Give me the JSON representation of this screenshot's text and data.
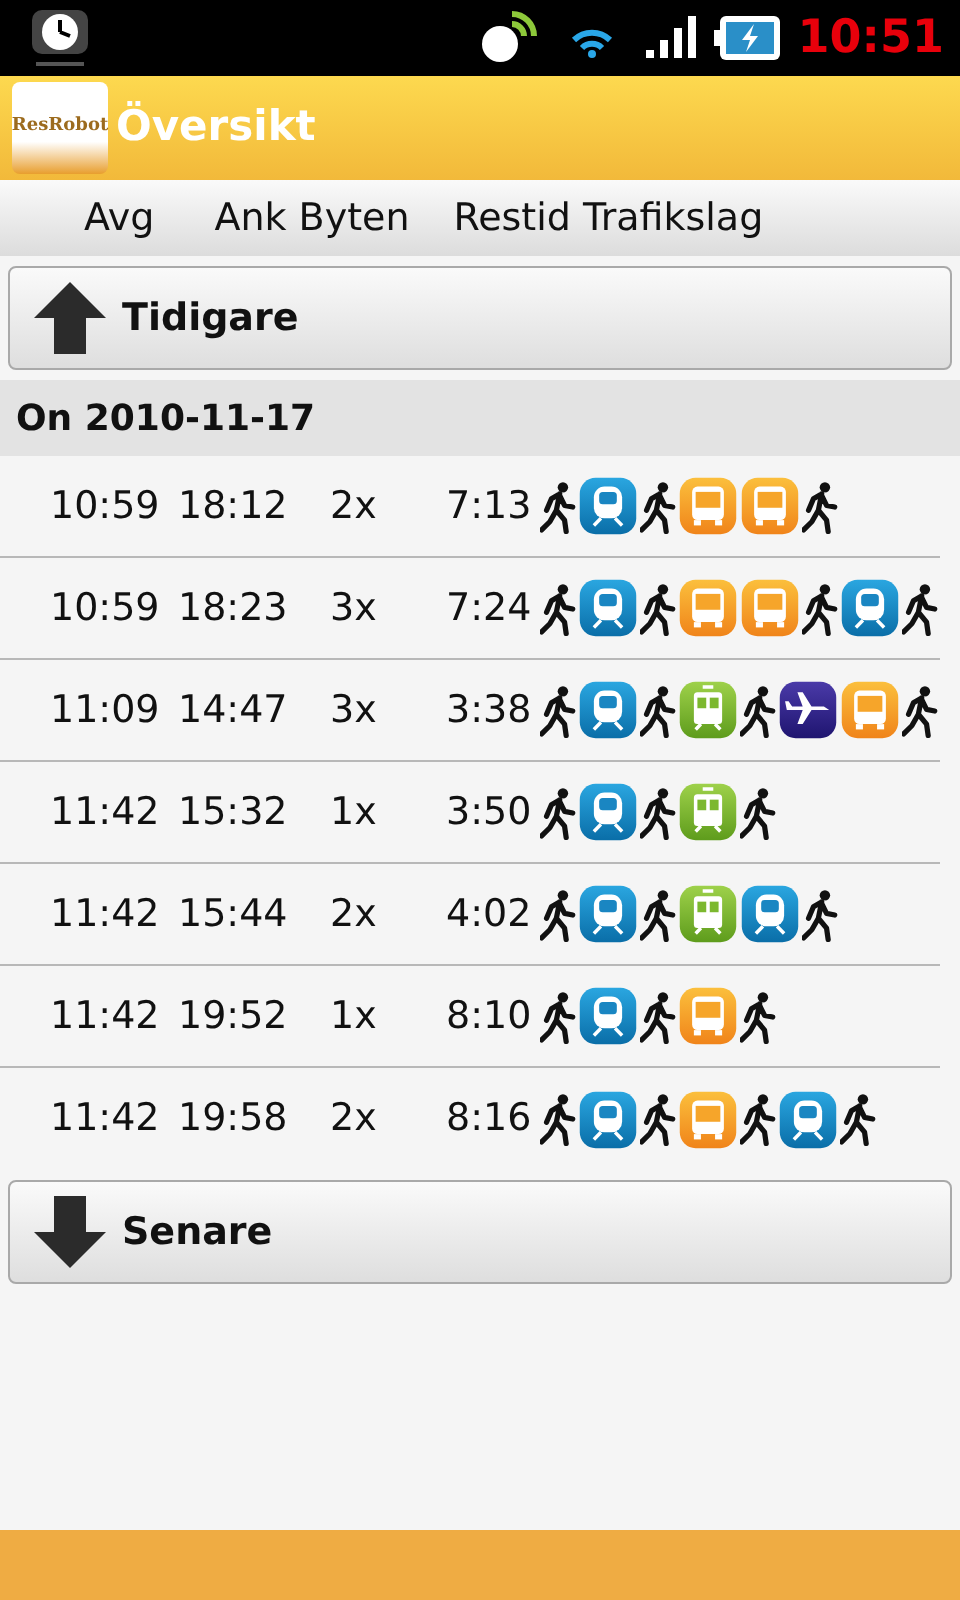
{
  "status_bar": {
    "time": "10:51"
  },
  "app_bar": {
    "title": "Översikt",
    "logo_text": "ResRobot"
  },
  "columns": [
    "Avg",
    "Ank Byten",
    "Restid Trafikslag"
  ],
  "earlier_button": {
    "label": "Tidigare"
  },
  "date_header": "On 2010-11-17",
  "trips": [
    {
      "departure": "10:59",
      "arrival": "18:12",
      "changes": "2x",
      "duration": "7:13",
      "legs": [
        {
          "kind": "walk"
        },
        {
          "kind": "train"
        },
        {
          "kind": "walk"
        },
        {
          "kind": "bus"
        },
        {
          "kind": "bus"
        },
        {
          "kind": "walk"
        }
      ]
    },
    {
      "departure": "10:59",
      "arrival": "18:23",
      "changes": "3x",
      "duration": "7:24",
      "legs": [
        {
          "kind": "walk"
        },
        {
          "kind": "train"
        },
        {
          "kind": "walk"
        },
        {
          "kind": "bus"
        },
        {
          "kind": "bus"
        },
        {
          "kind": "walk"
        },
        {
          "kind": "train"
        },
        {
          "kind": "walk"
        }
      ]
    },
    {
      "departure": "11:09",
      "arrival": "14:47",
      "changes": "3x",
      "duration": "3:38",
      "legs": [
        {
          "kind": "walk"
        },
        {
          "kind": "train"
        },
        {
          "kind": "walk"
        },
        {
          "kind": "tram"
        },
        {
          "kind": "walk"
        },
        {
          "kind": "plane"
        },
        {
          "kind": "bus"
        },
        {
          "kind": "walk"
        }
      ]
    },
    {
      "departure": "11:42",
      "arrival": "15:32",
      "changes": "1x",
      "duration": "3:50",
      "legs": [
        {
          "kind": "walk"
        },
        {
          "kind": "train"
        },
        {
          "kind": "walk"
        },
        {
          "kind": "tram"
        },
        {
          "kind": "walk"
        }
      ]
    },
    {
      "departure": "11:42",
      "arrival": "15:44",
      "changes": "2x",
      "duration": "4:02",
      "legs": [
        {
          "kind": "walk"
        },
        {
          "kind": "train"
        },
        {
          "kind": "walk"
        },
        {
          "kind": "tram"
        },
        {
          "kind": "train"
        },
        {
          "kind": "walk"
        }
      ]
    },
    {
      "departure": "11:42",
      "arrival": "19:52",
      "changes": "1x",
      "duration": "8:10",
      "legs": [
        {
          "kind": "walk"
        },
        {
          "kind": "train"
        },
        {
          "kind": "walk"
        },
        {
          "kind": "bus"
        },
        {
          "kind": "walk"
        }
      ]
    },
    {
      "departure": "11:42",
      "arrival": "19:58",
      "changes": "2x",
      "duration": "8:16",
      "legs": [
        {
          "kind": "walk"
        },
        {
          "kind": "train"
        },
        {
          "kind": "walk"
        },
        {
          "kind": "bus"
        },
        {
          "kind": "walk"
        },
        {
          "kind": "train"
        },
        {
          "kind": "walk"
        }
      ]
    }
  ],
  "later_button": {
    "label": "Senare"
  }
}
